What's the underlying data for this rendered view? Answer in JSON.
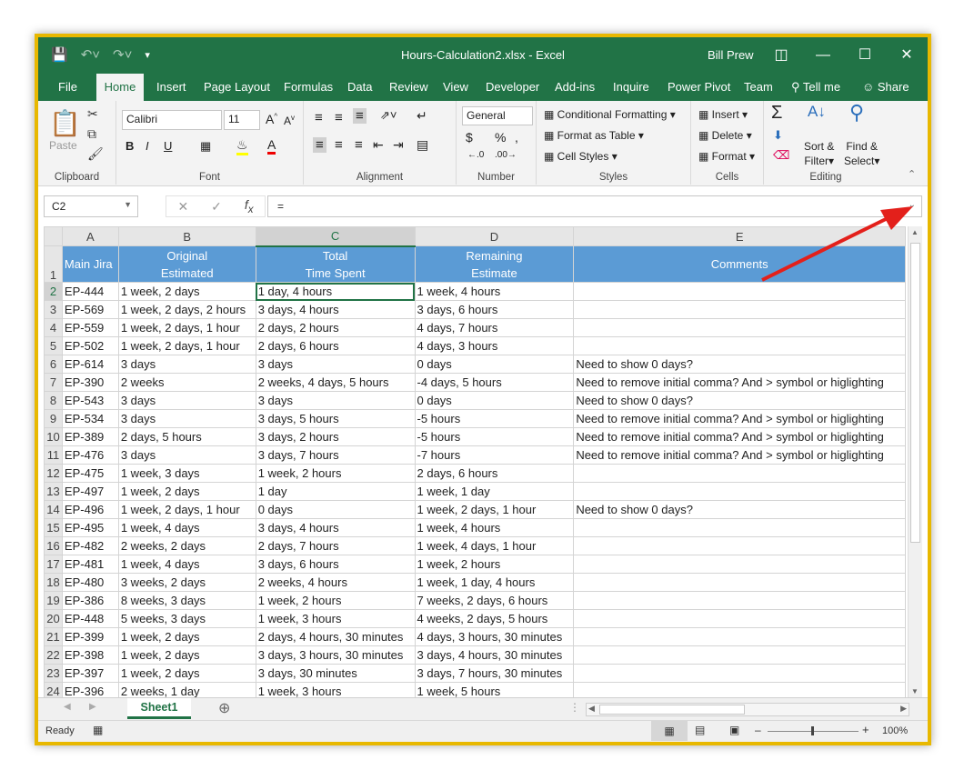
{
  "app": {
    "title": "Hours-Calculation2.xlsx  -  Excel",
    "user": "Bill Prew",
    "accent": "#217346",
    "header_fill": "#5b9bd5"
  },
  "tabs": [
    "File",
    "Home",
    "Insert",
    "Page Layout",
    "Formulas",
    "Data",
    "Review",
    "View",
    "Developer",
    "Add-ins",
    "Inquire",
    "Power Pivot",
    "Team",
    "Tell me",
    "Share"
  ],
  "ribbon": {
    "clipboard": {
      "label": "Clipboard",
      "paste": "Paste"
    },
    "font": {
      "label": "Font",
      "name": "Calibri",
      "size": "11"
    },
    "alignment": {
      "label": "Alignment"
    },
    "number": {
      "label": "Number",
      "format": "General"
    },
    "styles": {
      "label": "Styles",
      "conditional": "Conditional Formatting",
      "format_table": "Format as Table",
      "cell_styles": "Cell Styles"
    },
    "cells": {
      "label": "Cells",
      "insert": "Insert",
      "delete": "Delete",
      "format": "Format"
    },
    "editing": {
      "label": "Editing",
      "sort1": "Sort &",
      "sort2": "Filter",
      "find1": "Find &",
      "find2": "Select"
    }
  },
  "formula_bar": {
    "name_box": "C2",
    "formula": "="
  },
  "columns": [
    "A",
    "B",
    "C",
    "D",
    "E"
  ],
  "header_row": [
    "Main Jira",
    "Original\nEstimated",
    "Total\nTime Spent",
    "Remaining\nEstimate",
    "Comments"
  ],
  "rows": [
    [
      "EP-444",
      "1 week, 2 days",
      "1 day, 4 hours",
      "1 week, 4 hours",
      ""
    ],
    [
      "EP-569",
      "1 week, 2 days, 2 hours",
      "3 days, 4 hours",
      "3 days, 6 hours",
      ""
    ],
    [
      "EP-559",
      "1 week, 2 days, 1 hour",
      "2 days, 2 hours",
      "4 days, 7 hours",
      ""
    ],
    [
      "EP-502",
      "1 week, 2 days, 1 hour",
      "2 days, 6 hours",
      "4 days, 3 hours",
      ""
    ],
    [
      "EP-614",
      "3 days",
      "3 days",
      "0 days",
      "Need to show 0 days?"
    ],
    [
      "EP-390",
      "2 weeks",
      "2 weeks, 4 days, 5 hours",
      "-4 days, 5 hours",
      "Need to remove initial comma? And > symbol or higlighting"
    ],
    [
      "EP-543",
      "3 days",
      "3 days",
      "0 days",
      "Need to show 0 days?"
    ],
    [
      "EP-534",
      "3 days",
      "3 days, 5 hours",
      "-5 hours",
      "Need to remove initial comma? And > symbol or higlighting"
    ],
    [
      "EP-389",
      "2 days, 5 hours",
      "3 days, 2 hours",
      "-5 hours",
      "Need to remove initial comma? And > symbol or higlighting"
    ],
    [
      "EP-476",
      "3 days",
      "3 days, 7 hours",
      "-7 hours",
      "Need to remove initial comma? And > symbol or higlighting"
    ],
    [
      "EP-475",
      "1 week, 3 days",
      "1 week, 2 hours",
      "2 days, 6 hours",
      ""
    ],
    [
      "EP-497",
      "1 week, 2 days",
      "1 day",
      "1 week, 1 day",
      ""
    ],
    [
      "EP-496",
      "1 week, 2 days, 1 hour",
      "0 days",
      "1 week, 2 days, 1 hour",
      "Need to show 0 days?"
    ],
    [
      "EP-495",
      "1 week, 4 days",
      "3 days, 4 hours",
      "1 week, 4 hours",
      ""
    ],
    [
      "EP-482",
      "2 weeks, 2 days",
      "2 days, 7 hours",
      "1 week, 4 days, 1 hour",
      ""
    ],
    [
      "EP-481",
      "1 week, 4 days",
      "3 days, 6 hours",
      "1 week, 2 hours",
      ""
    ],
    [
      "EP-480",
      "3 weeks, 2 days",
      "2 weeks, 4 hours",
      "1 week, 1 day, 4 hours",
      ""
    ],
    [
      "EP-386",
      "8 weeks, 3 days",
      "1 week, 2 hours",
      "7 weeks, 2 days, 6 hours",
      ""
    ],
    [
      "EP-448",
      "5 weeks, 3 days",
      "1 week, 3 hours",
      "4 weeks, 2 days, 5 hours",
      ""
    ],
    [
      "EP-399",
      "1 week, 2 days",
      "2 days, 4 hours, 30 minutes",
      "4 days, 3 hours, 30 minutes",
      ""
    ],
    [
      "EP-398",
      "1 week, 2 days",
      "3 days, 3 hours, 30 minutes",
      "3 days, 4 hours, 30 minutes",
      ""
    ],
    [
      "EP-397",
      "1 week, 2 days",
      "3 days, 30 minutes",
      "3 days, 7 hours, 30 minutes",
      ""
    ],
    [
      "EP-396",
      "2 weeks, 1 day",
      "1 week, 3 hours",
      "1 week, 5 hours",
      ""
    ]
  ],
  "sheet_tab": "Sheet1",
  "status": {
    "ready": "Ready",
    "zoom": "100%"
  }
}
